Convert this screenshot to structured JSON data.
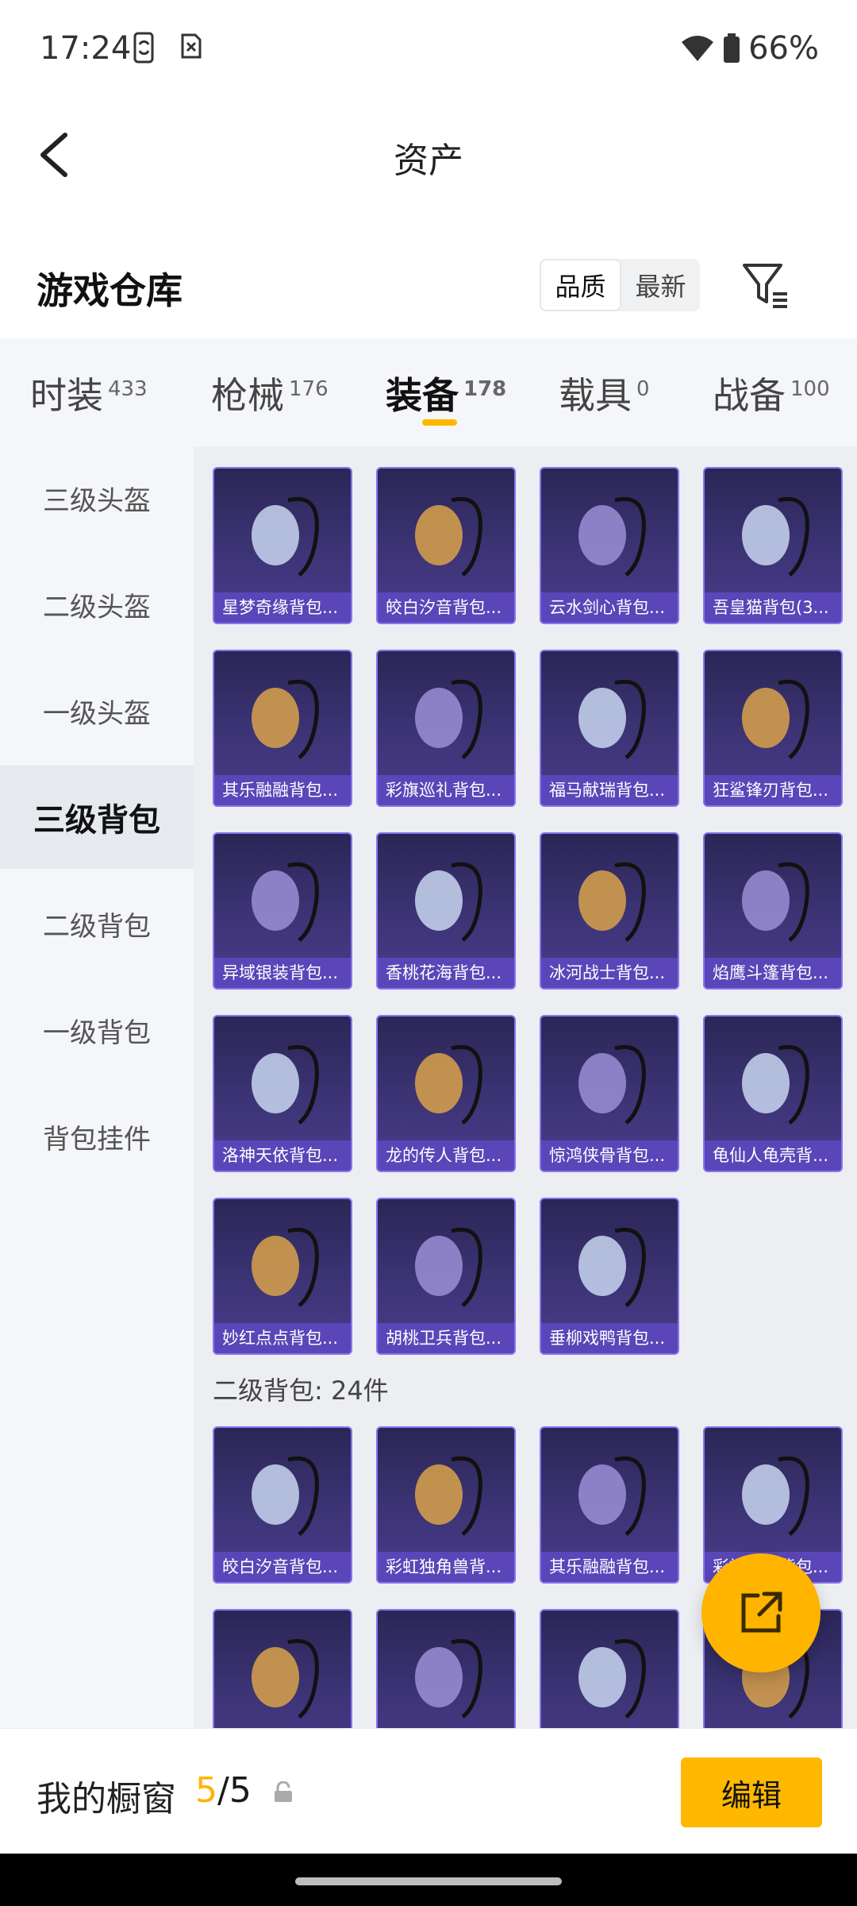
{
  "status_bar": {
    "time": "17:24",
    "battery": "66%"
  },
  "header": {
    "title": "资产"
  },
  "warehouse": {
    "title": "游戏仓库",
    "sort_options": [
      "品质",
      "最新"
    ],
    "active_sort": "品质"
  },
  "categories": [
    {
      "label": "时装",
      "count": "433"
    },
    {
      "label": "枪械",
      "count": "176"
    },
    {
      "label": "装备",
      "count": "178"
    },
    {
      "label": "载具",
      "count": "0"
    },
    {
      "label": "战备",
      "count": "100"
    }
  ],
  "active_category": "装备",
  "sidebar": {
    "items": [
      "三级头盔",
      "二级头盔",
      "一级头盔",
      "三级背包",
      "二级背包",
      "一级背包",
      "背包挂件"
    ],
    "active": "三级背包"
  },
  "grid_level3": [
    "星梦奇缘背包...",
    "皎白汐音背包...",
    "云水剑心背包...",
    "吾皇猫背包(3...",
    "其乐融融背包...",
    "彩旗巡礼背包...",
    "福马献瑞背包...",
    "狂鲨锋刃背包...",
    "异域银装背包...",
    "香桃花海背包...",
    "冰河战士背包...",
    "焰鹰斗篷背包...",
    "洛神天依背包...",
    "龙的传人背包...",
    "惊鸿侠骨背包...",
    "龟仙人龟壳背...",
    "妙红点点背包...",
    "胡桃卫兵背包...",
    "垂柳戏鸭背包..."
  ],
  "section_level2": {
    "label": "二级背包: 24件"
  },
  "grid_level2": [
    "皎白汐音背包...",
    "彩虹独角兽背...",
    "其乐融融背包...",
    "彩旗巡礼背包...",
    "",
    "",
    "",
    ""
  ],
  "bottom_bar": {
    "label": "我的橱窗",
    "current": "5",
    "separator": "/",
    "total": "5",
    "edit_label": "编辑"
  },
  "colors": {
    "accent": "#ffb800",
    "card_bg": "#3d3476",
    "card_label": "#5a46b8"
  }
}
